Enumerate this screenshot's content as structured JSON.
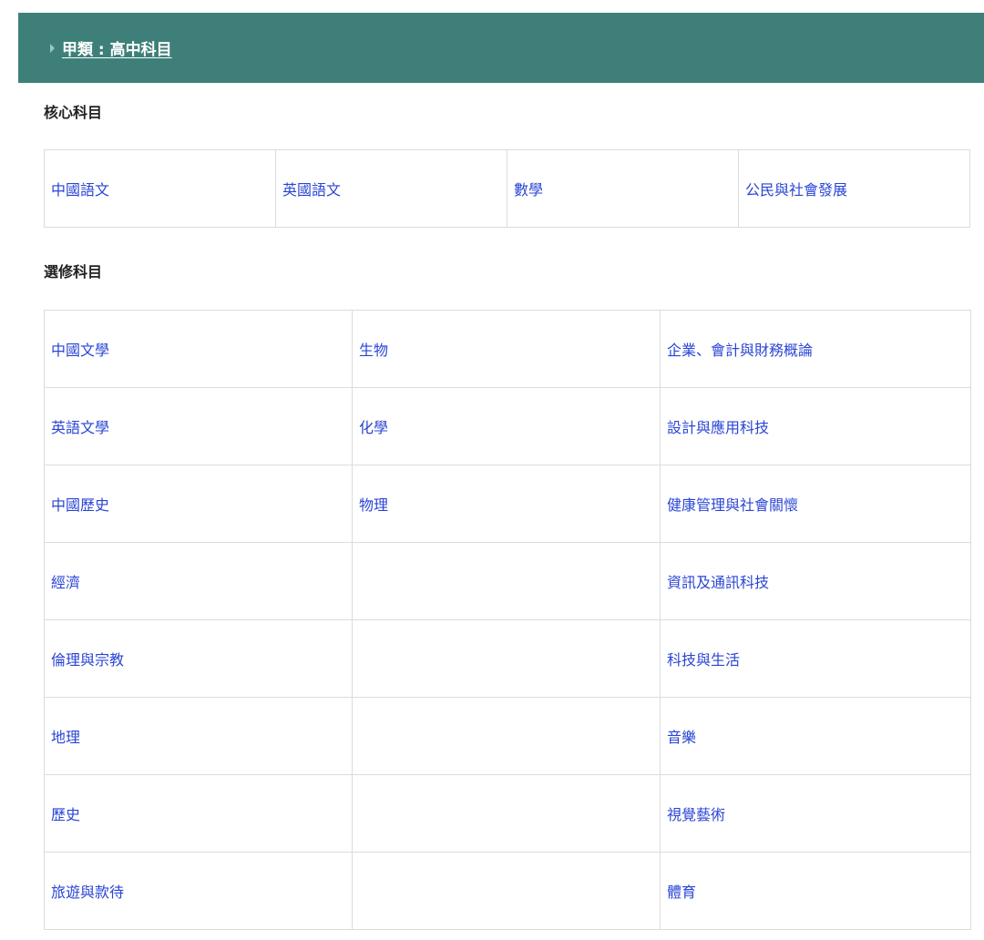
{
  "banner": {
    "title": "甲類 : 高中科目"
  },
  "core": {
    "heading": "核心科目",
    "subjects": [
      "中國語文",
      "英國語文",
      "數學",
      "公民與社會發展"
    ]
  },
  "elective": {
    "heading": "選修科目",
    "rows": [
      [
        "中國文學",
        "生物",
        "企業、會計與財務概論"
      ],
      [
        "英語文學",
        "化學",
        "設計與應用科技"
      ],
      [
        "中國歷史",
        "物理",
        "健康管理與社會關懷"
      ],
      [
        "經濟",
        "",
        "資訊及通訊科技"
      ],
      [
        "倫理與宗教",
        "",
        "科技與生活"
      ],
      [
        "地理",
        "",
        "音樂"
      ],
      [
        "歷史",
        "",
        "視覺藝術"
      ],
      [
        "旅遊與款待",
        "",
        "體育"
      ]
    ]
  }
}
